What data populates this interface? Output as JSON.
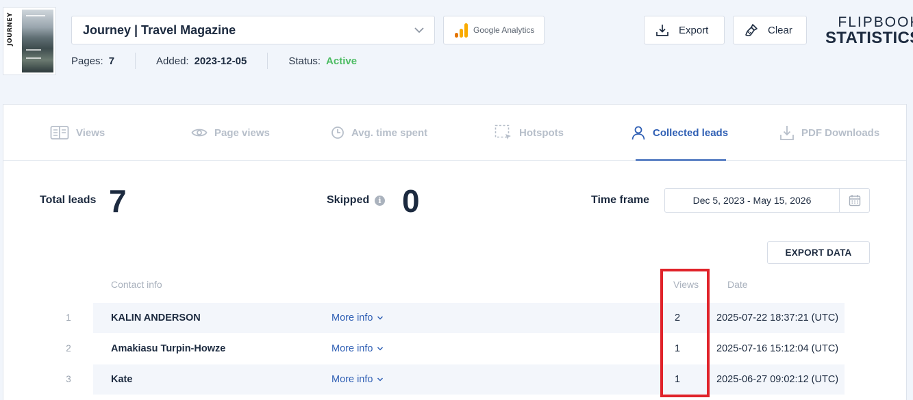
{
  "publication": {
    "title": "Journey | Travel Magazine",
    "thumbnail_text": "JOURNEY",
    "pages_label": "Pages:",
    "pages_value": "7",
    "added_label": "Added:",
    "added_value": "2023-12-05",
    "status_label": "Status:",
    "status_value": "Active"
  },
  "header": {
    "ga_label": "Google Analytics",
    "export_label": "Export",
    "clear_label": "Clear",
    "brand_line1": "FLIPBOOK",
    "brand_line2": "STATISTICS"
  },
  "tabs": [
    {
      "label": "Views",
      "icon": "views-icon",
      "active": false
    },
    {
      "label": "Page views",
      "icon": "eye-icon",
      "active": false
    },
    {
      "label": "Avg. time spent",
      "icon": "clock-icon",
      "active": false
    },
    {
      "label": "Hotspots",
      "icon": "hotspot-icon",
      "active": false
    },
    {
      "label": "Collected leads",
      "icon": "user-icon",
      "active": true
    },
    {
      "label": "PDF Downloads",
      "icon": "download-icon",
      "active": false
    }
  ],
  "stats": {
    "total_leads_label": "Total leads",
    "total_leads_value": "7",
    "skipped_label": "Skipped",
    "skipped_value": "0",
    "time_frame_label": "Time frame",
    "time_frame_value": "Dec 5, 2023 - May 15, 2026"
  },
  "export_data_label": "EXPORT DATA",
  "table": {
    "headers": {
      "contact": "Contact info",
      "views": "Views",
      "date": "Date"
    },
    "more_info_label": "More info",
    "rows": [
      {
        "index": "1",
        "name": "KALIN ANDERSON",
        "views": "2",
        "date": "2025-07-22 18:37:21 (UTC)"
      },
      {
        "index": "2",
        "name": "Amakiasu Turpin-Howze",
        "views": "1",
        "date": "2025-07-16 15:12:04 (UTC)"
      },
      {
        "index": "3",
        "name": "Kate",
        "views": "1",
        "date": "2025-06-27 09:02:12 (UTC)"
      }
    ]
  },
  "colors": {
    "accent": "#2f5fb4",
    "status_active": "#4cbc62",
    "highlight_box": "#e0232a",
    "ga_orange": "#f9ab00",
    "ga_dark_orange": "#e37400"
  }
}
